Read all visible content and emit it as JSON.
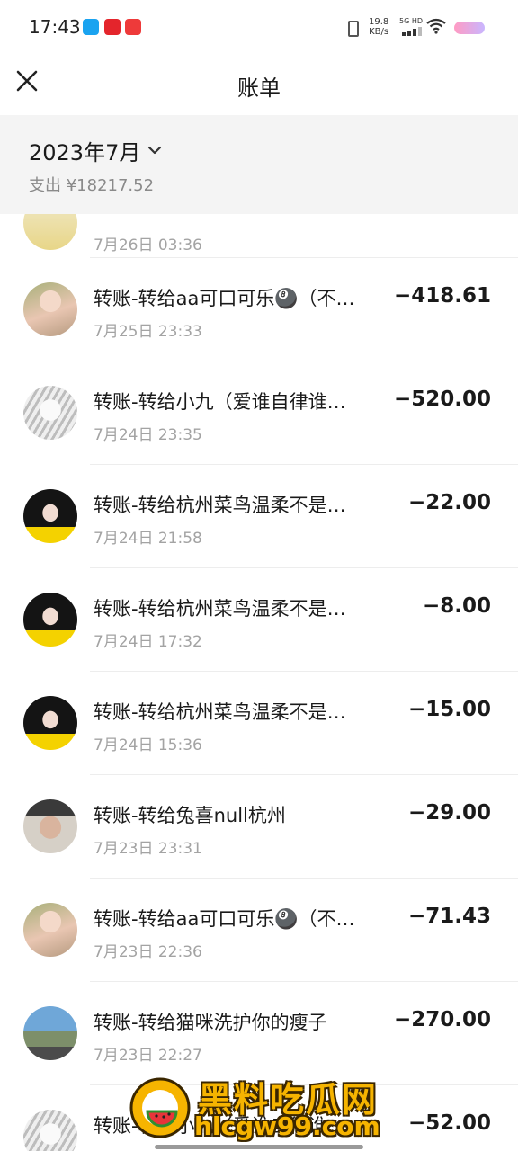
{
  "status_bar": {
    "time": "17:43",
    "speed_value": "19.8",
    "speed_unit": "KB/s",
    "network": "5G HD",
    "icons": [
      "vibrate-icon",
      "signal-icon",
      "wifi-icon",
      "battery-icon"
    ]
  },
  "nav": {
    "title": "账单",
    "close_icon": "close-icon"
  },
  "month": {
    "label": "2023年7月",
    "expense": "支出 ¥18217.52"
  },
  "transactions": [
    {
      "title": "",
      "time": "7月26日 03:36",
      "amount": "",
      "avatar": "partial"
    },
    {
      "title": "转账-转给aa可口可乐🎱（不…",
      "time": "7月25日 23:33",
      "amount": "−418.61",
      "avatar": "doll"
    },
    {
      "title": "转账-转给小九（爱谁自律谁…",
      "time": "7月24日 23:35",
      "amount": "−520.00",
      "avatar": "sketch"
    },
    {
      "title": "转账-转给杭州菜鸟温柔不是…",
      "time": "7月24日 21:58",
      "amount": "−22.00",
      "avatar": "girl"
    },
    {
      "title": "转账-转给杭州菜鸟温柔不是…",
      "time": "7月24日 17:32",
      "amount": "−8.00",
      "avatar": "girl"
    },
    {
      "title": "转账-转给杭州菜鸟温柔不是…",
      "time": "7月24日 15:36",
      "amount": "−15.00",
      "avatar": "girl"
    },
    {
      "title": "转账-转给兔喜null杭州",
      "time": "7月23日 23:31",
      "amount": "−29.00",
      "avatar": "boy"
    },
    {
      "title": "转账-转给aa可口可乐🎱（不…",
      "time": "7月23日 22:36",
      "amount": "−71.43",
      "avatar": "doll"
    },
    {
      "title": "转账-转给猫咪洗护你的瘦子",
      "time": "7月23日 22:27",
      "amount": "−270.00",
      "avatar": "scenery"
    },
    {
      "title": "转账-转给小九（爱谁自律谁…",
      "time": "",
      "amount": "−52.00",
      "avatar": "sketch"
    }
  ],
  "watermark": {
    "name": "黑料吃瓜网",
    "url": "hlcgw99.com"
  }
}
